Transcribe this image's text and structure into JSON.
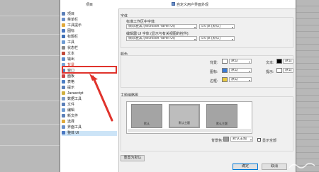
{
  "dialog": {
    "title": "自定义用户界面外观",
    "sidebar_header": "项目",
    "sidebar_items": [
      {
        "label": "项目",
        "color": "#5b7fb8"
      },
      {
        "label": "菜单栏",
        "color": "#6a8fc9"
      },
      {
        "label": "工具提示",
        "color": "#e0a93b"
      },
      {
        "label": "图标",
        "color": "#4a78c2"
      },
      {
        "label": "标题栏",
        "color": "#3f6fb5"
      },
      {
        "label": "工具",
        "color": "#6d9bd3"
      },
      {
        "label": "状态栏",
        "color": "#888888"
      },
      {
        "label": "文本",
        "color": "#c04a3a"
      },
      {
        "label": "输出",
        "color": "#5b8bcc"
      },
      {
        "label": "背景",
        "color": "#7aa5d8"
      },
      {
        "label": "窗口",
        "color": "#5b7fb8"
      },
      {
        "label": "面板",
        "color": "#cc4444"
      },
      {
        "label": "表格",
        "color": "#4c7ec4"
      },
      {
        "label": "提示",
        "color": "#5b7fb8"
      },
      {
        "label": "Javascript",
        "color": "#d0b040"
      },
      {
        "label": "数据工具",
        "color": "#7a9ac8"
      },
      {
        "label": "文件",
        "color": "#5b7fb8"
      },
      {
        "label": "编辑",
        "color": "#6d9bd3"
      },
      {
        "label": "新文件",
        "color": "#5b7fb8"
      },
      {
        "label": "选择",
        "color": "#e0a93b"
      },
      {
        "label": "界面工具",
        "color": "#6a8fc9"
      },
      {
        "label": "整体 UI",
        "color": "#4a78c2"
      }
    ],
    "highlighted_index": 9,
    "selected_index": 21,
    "font_section_label": "字体",
    "font1_label": "标准工作区中字体:",
    "font1_value": "微软雅黑 (Microsoft YaHei UI)",
    "font1_size": "9.0 pt (默认)",
    "font2_label": "编辑器 UI 字体 (显示与有关视图的控件):",
    "font2_value": "微软雅黑 (Microsoft YaHei UI)",
    "font2_size": "9.0 pt (默认)",
    "color_section_label": "颜色",
    "bg_label": "背景:",
    "bg_value": "默认",
    "icon_label": "图标:",
    "icon_value": "默认",
    "border_label": "边框:",
    "border_value": "默认",
    "text_label": "文本:",
    "text_value": "默认",
    "hint_label": "提示:",
    "hint_value": "默认",
    "colors": {
      "bg": "#ffffff",
      "icon": "#3a7bd5",
      "border": "#e8c840",
      "text": "#000000",
      "hint": "#ffffff"
    },
    "preview_section_label": "主题缩略图",
    "tiles": [
      "默认",
      "默认主题",
      "默认主题"
    ],
    "theme_label": "背景色:",
    "theme_value": "默认主题",
    "show_check_label": "显示全部",
    "reset_button": "重置为默认",
    "ok_button": "确定",
    "cancel_button": "取消"
  }
}
